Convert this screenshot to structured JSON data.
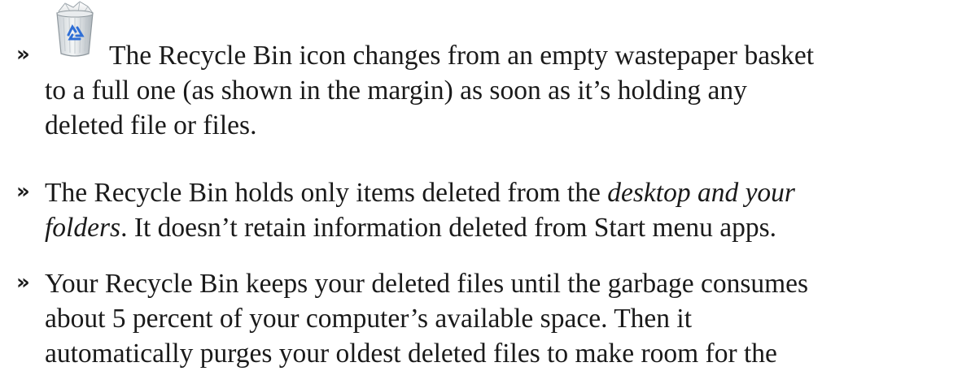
{
  "bullet_glyph": "»",
  "icon": "recycle-bin-full-icon",
  "items": [
    {
      "line1": "The Recycle Bin icon changes from an empty wastepaper basket",
      "line2": "to a full one (as shown in the margin) as soon as it’s holding any",
      "line3": "deleted file or files."
    },
    {
      "line1_a": "The Recycle Bin holds only items deleted from the ",
      "line1_em": "desktop and your",
      "line2_em": "folders",
      "line2_b": ". It doesn’t retain information deleted from Start menu apps."
    },
    {
      "line1": "Your Recycle Bin keeps your deleted files until the garbage consumes",
      "line2": "about 5 percent of your computer’s available space. Then it",
      "line3": "automatically purges your oldest deleted files to make room for the"
    }
  ]
}
